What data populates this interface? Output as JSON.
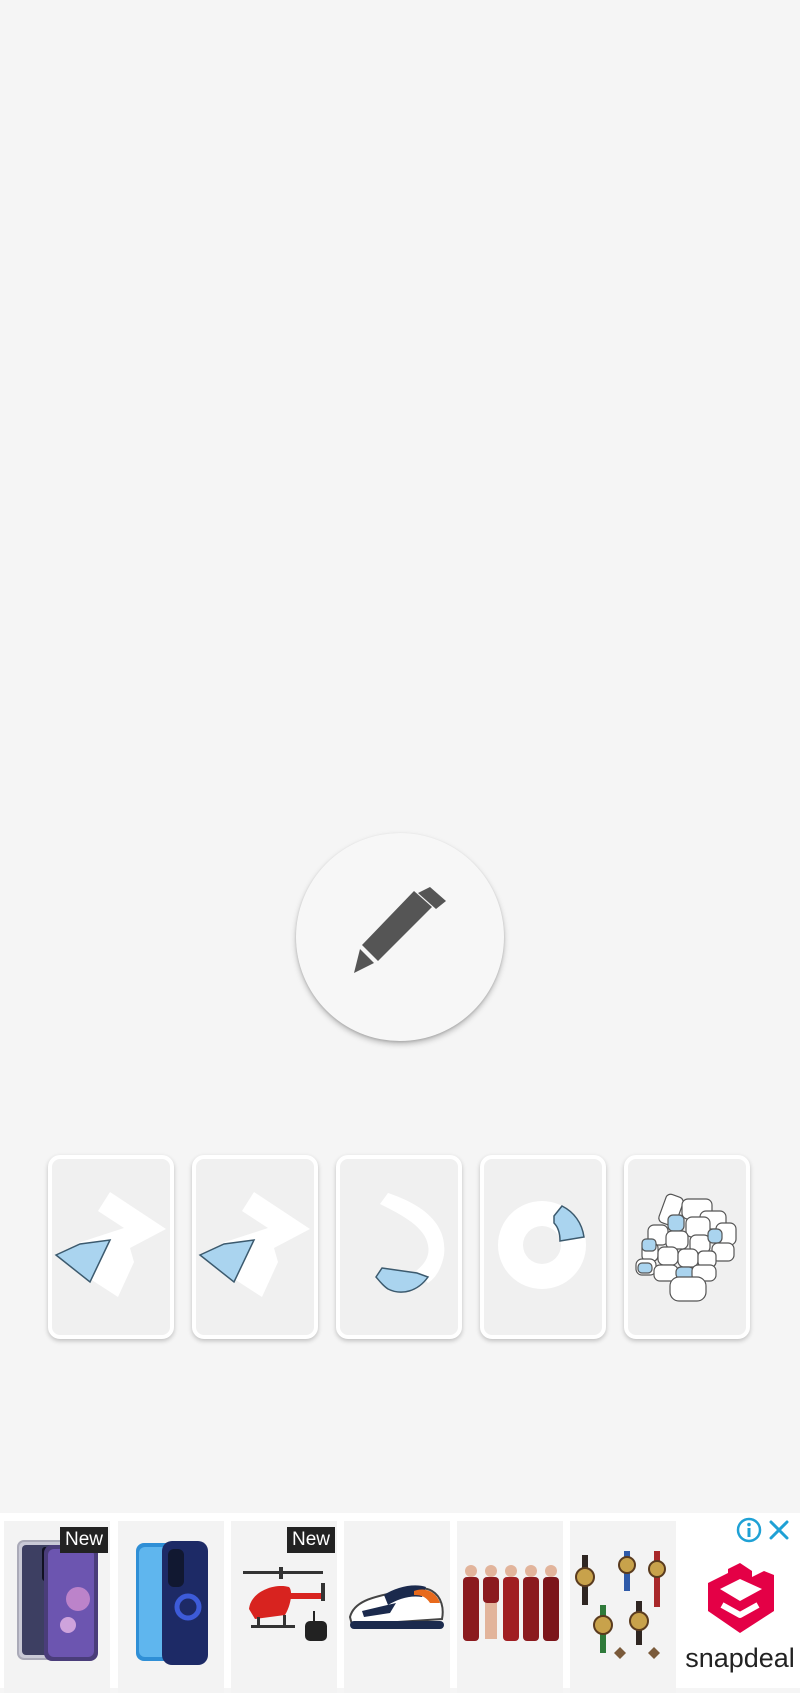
{
  "colors": {
    "background": "#f5f5f5",
    "card_background": "#f0f0f0",
    "shape_white": "#ffffff",
    "shape_blue": "#aad4ef",
    "pencil": "#555555",
    "brand_red": "#e40046",
    "ad_info": "#1fa1d5"
  },
  "edit_button": {
    "icon": "pencil-icon"
  },
  "puzzle_cards": [
    {
      "icon": "zigzag-shape-icon"
    },
    {
      "icon": "zigzag-shape-icon"
    },
    {
      "icon": "hook-shape-icon"
    },
    {
      "icon": "ring-shape-icon"
    },
    {
      "icon": "stone-wall-icon"
    }
  ],
  "ad": {
    "badge_new": "New",
    "products": [
      {
        "item": "phone-case-icon",
        "badge": true
      },
      {
        "item": "phone-ring-case-icon",
        "badge": false
      },
      {
        "item": "rc-helicopter-icon",
        "badge": true
      },
      {
        "item": "sneaker-icon",
        "badge": false
      },
      {
        "item": "nightwear-set-icon",
        "badge": false
      },
      {
        "item": "vintage-watches-icon",
        "badge": false
      }
    ],
    "brand": "snapdeal",
    "info_icon": "info-icon",
    "close_icon": "close-icon"
  }
}
